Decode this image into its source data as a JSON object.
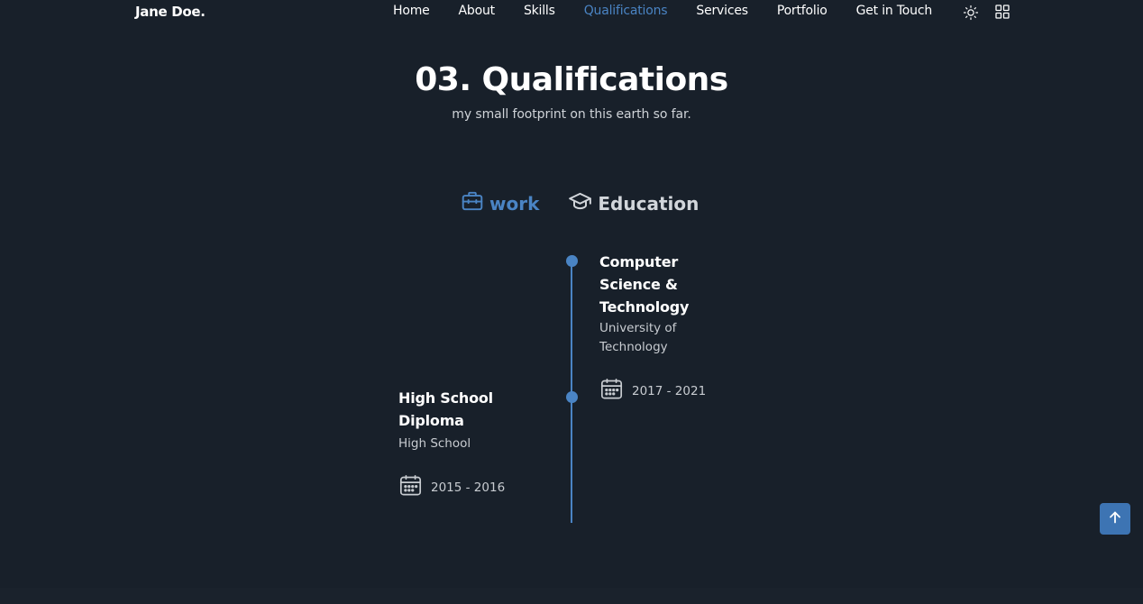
{
  "brand": "Jane Doe.",
  "nav": {
    "items": [
      {
        "label": "Home"
      },
      {
        "label": "About"
      },
      {
        "label": "Skills"
      },
      {
        "label": "Qualifications",
        "active": true
      },
      {
        "label": "Services"
      },
      {
        "label": "Portfolio"
      },
      {
        "label": "Get in Touch"
      }
    ],
    "icons": [
      "sun-icon",
      "grid-menu-icon"
    ]
  },
  "section": {
    "title": "03. Qualifications",
    "subtitle": "my small footprint on this earth so far."
  },
  "tabs": [
    {
      "label": "work",
      "icon": "briefcase-icon",
      "active": true
    },
    {
      "label": "Education",
      "icon": "graduation-cap-icon",
      "active": false
    }
  ],
  "qualifications": [
    {
      "title": "Computer Science & Technology",
      "subtitle": "University of Technology",
      "date": "2017 - 2021",
      "side": "right"
    },
    {
      "title": "High School Diploma",
      "subtitle": "High School",
      "date": "2015 - 2016",
      "side": "left"
    }
  ],
  "colors": {
    "background": "#18202a",
    "accent": "#4a84c4",
    "text": "#ffffff",
    "muted": "#c8ccd1"
  }
}
